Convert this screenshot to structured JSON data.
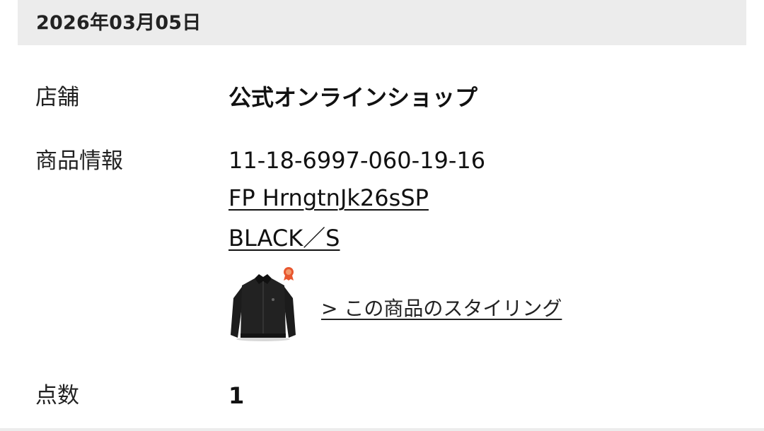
{
  "header": {
    "date": "2026年03月05日"
  },
  "order": {
    "store_label": "店舗",
    "store_value": "公式オンラインショップ",
    "product_label": "商品情報",
    "product_code": "11-18-6997-060-19-16",
    "product_name": "FP HrngtnJk26sSP",
    "product_variant": "BLACK／S",
    "styling_link": "> この商品のスタイリング",
    "quantity_label": "点数",
    "quantity_value": "1"
  },
  "icons": {
    "thumbnail": "black-jacket-image",
    "badge": "orange-medal-badge-icon"
  },
  "colors": {
    "header_bg": "#ececec",
    "text": "#1a1a1a",
    "badge": "#e8572f"
  }
}
